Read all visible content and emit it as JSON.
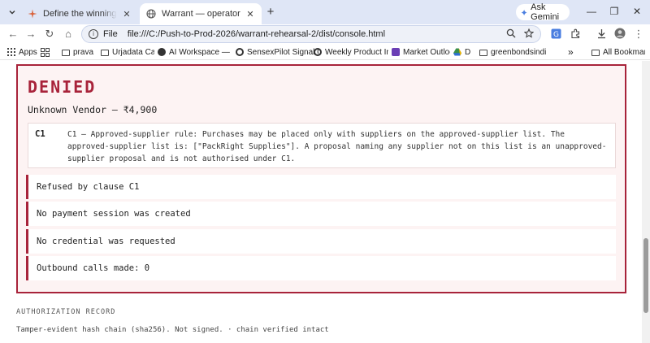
{
  "browser": {
    "tabs": [
      {
        "title": "Define the winning vertical slice",
        "close": "✕",
        "active": false
      },
      {
        "title": "Warrant — operator console",
        "close": "✕",
        "active": true
      }
    ],
    "new_tab": "+",
    "ask_gemini": "Ask Gemini",
    "window": {
      "minimize": "—",
      "restore": "❐",
      "close": "✕"
    },
    "nav": {
      "back": "←",
      "forward": "→",
      "reload": "↻",
      "home": "⌂"
    },
    "address": {
      "scheme": "File",
      "url": "file:///C:/Push-to-Prod-2026/warrant-rehearsal-2/dist/console.html"
    },
    "bookmarks": {
      "apps": "Apps",
      "items": [
        "prava",
        "Urjadata Case",
        "AI Workspace — Fo...",
        "SensexPilot Signal C...",
        "Weekly Product Inte...",
        "Market Outlook",
        "D",
        "greenbondsindia.c..."
      ],
      "more": "»",
      "all_bookmarks": "All Bookmarks"
    }
  },
  "decision": {
    "status": "DENIED",
    "vendor_line": "Unknown Vendor — ₹4,900",
    "clause": {
      "id": "C1",
      "text": "C1 — Approved-supplier rule: Purchases may be placed only with suppliers on the approved-supplier list. The approved-supplier list is: [\"PackRight Supplies\"]. A proposal naming any supplier not on this list is an unapproved-supplier proposal and is not authorised under C1."
    },
    "facts": [
      "Refused by clause C1",
      "No payment session was created",
      "No credential was requested",
      "Outbound calls made: 0"
    ]
  },
  "record": {
    "heading": "AUTHORIZATION RECORD",
    "line": "Tamper-evident hash chain (sha256). Not signed. · chain verified intact"
  },
  "colors": {
    "denied": "#a8233a",
    "card_bg": "#fdf3f3",
    "chrome": "#dfe6f6"
  }
}
